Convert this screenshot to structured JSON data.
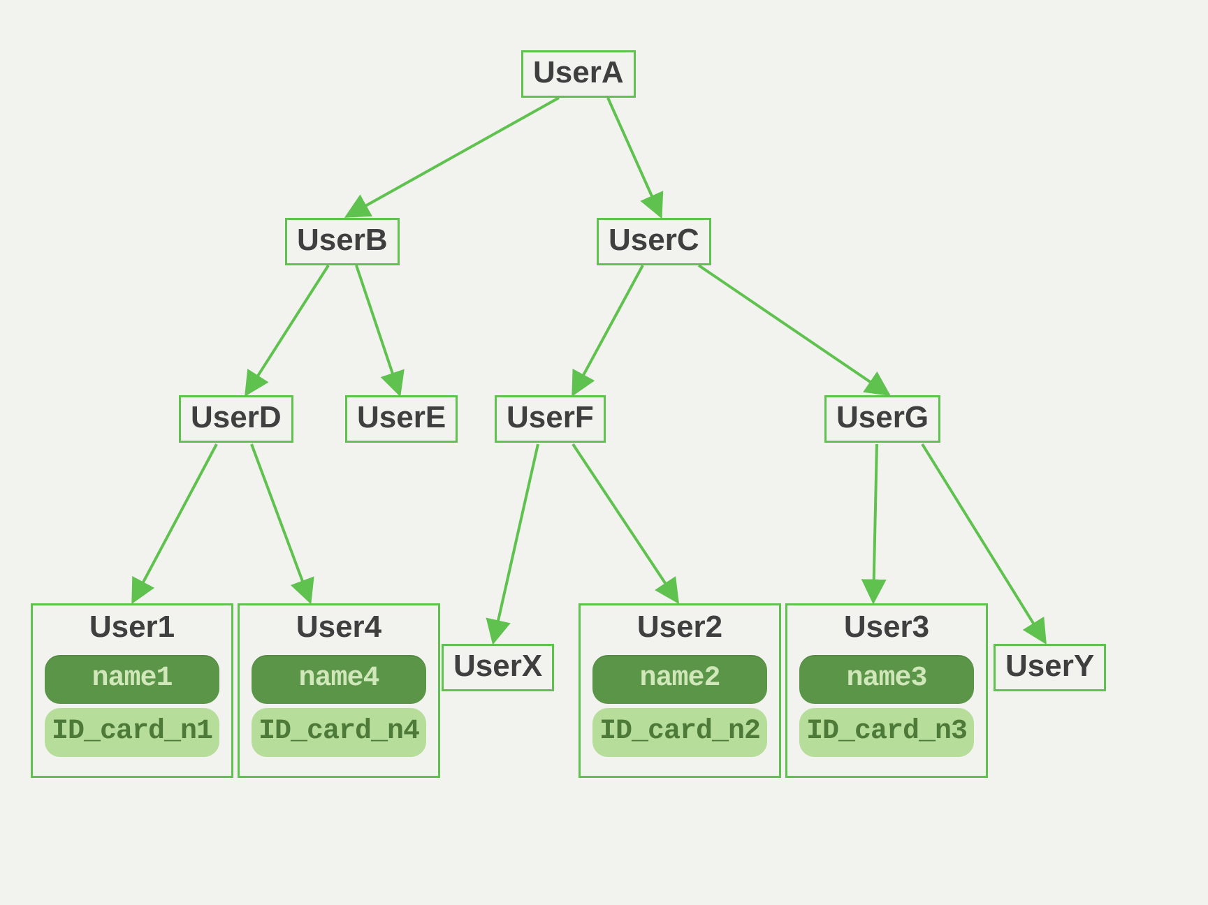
{
  "colors": {
    "stroke": "#5fc24e",
    "bg": "#f2f2ee",
    "text": "#3f3f3f",
    "pill_dark": "#5b9548",
    "pill_light": "#b6de9a"
  },
  "nodes": {
    "A": "UserA",
    "B": "UserB",
    "C": "UserC",
    "D": "UserD",
    "E": "UserE",
    "F": "UserF",
    "G": "UserG",
    "X": "UserX",
    "Y": "UserY"
  },
  "leaves": {
    "u1": {
      "title": "User1",
      "name": "name1",
      "id": "ID_card_n1"
    },
    "u4": {
      "title": "User4",
      "name": "name4",
      "id": "ID_card_n4"
    },
    "u2": {
      "title": "User2",
      "name": "name2",
      "id": "ID_card_n2"
    },
    "u3": {
      "title": "User3",
      "name": "name3",
      "id": "ID_card_n3"
    }
  },
  "edges": [
    [
      "A",
      "B"
    ],
    [
      "A",
      "C"
    ],
    [
      "B",
      "D"
    ],
    [
      "B",
      "E"
    ],
    [
      "C",
      "F"
    ],
    [
      "C",
      "G"
    ],
    [
      "D",
      "u1"
    ],
    [
      "D",
      "u4"
    ],
    [
      "F",
      "X"
    ],
    [
      "F",
      "u2"
    ],
    [
      "G",
      "u3"
    ],
    [
      "G",
      "Y"
    ]
  ]
}
